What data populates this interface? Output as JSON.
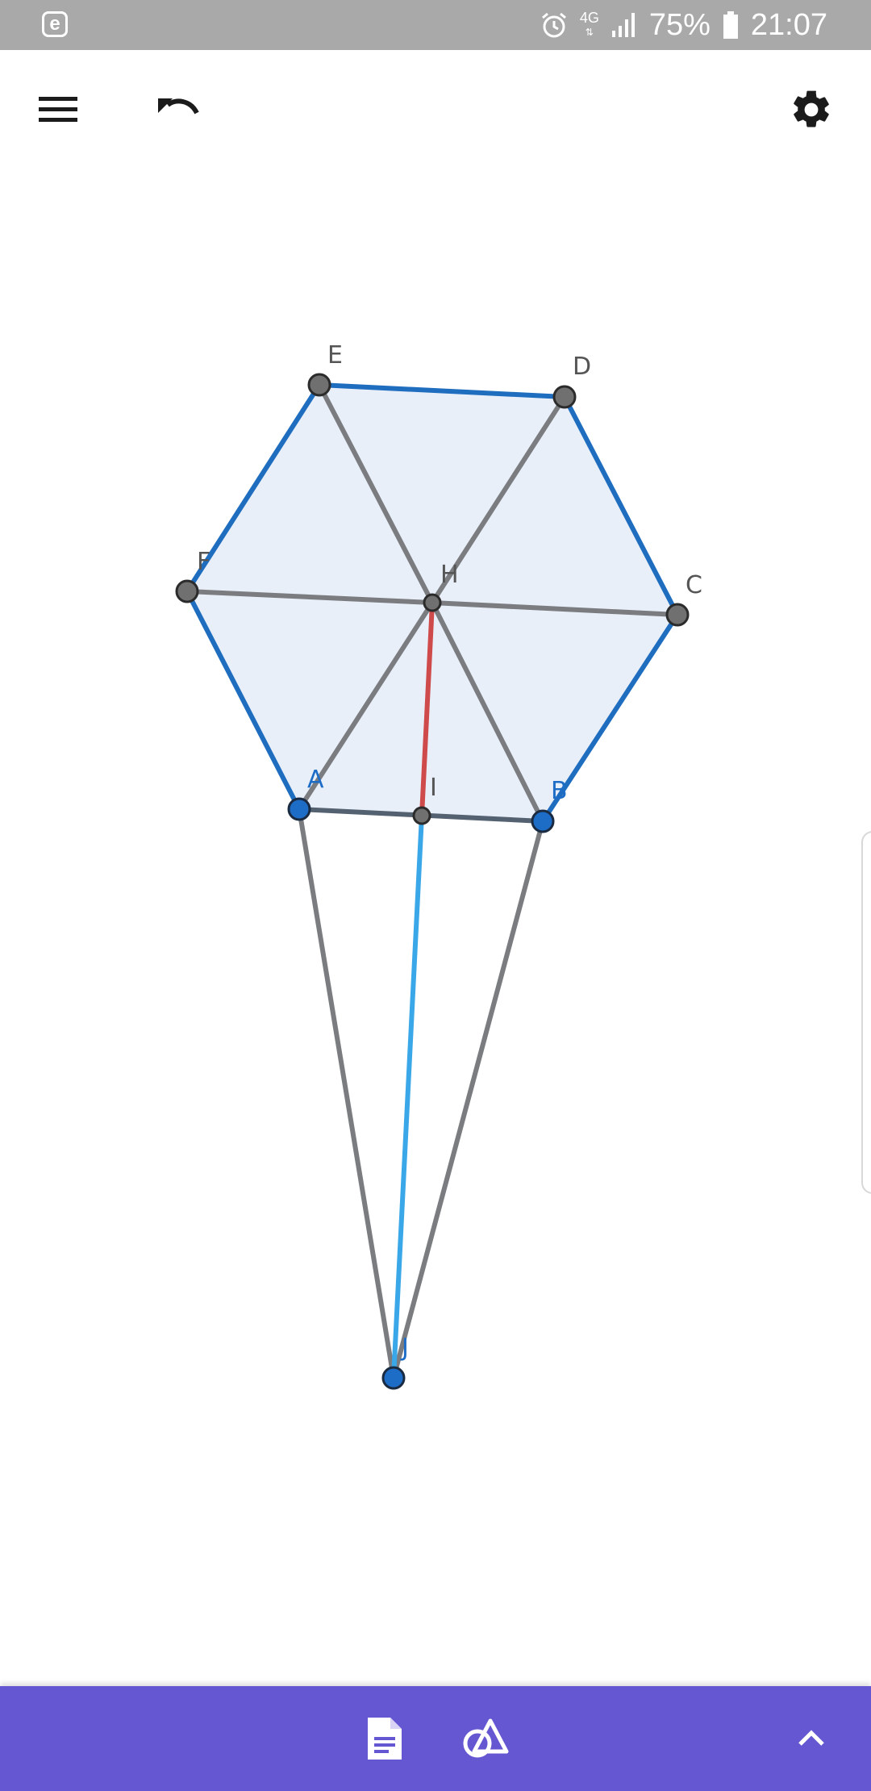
{
  "status_bar": {
    "left_icon_letter": "e",
    "network": "4G",
    "battery_percent": "75%",
    "time": "21:07",
    "icons": [
      "app-e-icon",
      "alarm-icon",
      "network-4g-icon",
      "signal-icon",
      "battery-icon"
    ]
  },
  "toolbar": {
    "menu_icon": "hamburger-menu-icon",
    "undo_icon": "undo-icon",
    "settings_icon": "gear-icon"
  },
  "geometry": {
    "points": {
      "A": "A",
      "B": "B",
      "C": "C",
      "D": "D",
      "E": "E",
      "F": "F",
      "H": "H",
      "I": "I",
      "J": "J"
    },
    "colors": {
      "polygon_fill": "#e8eff9",
      "polygon_edge": "#1f6dbf",
      "segment_gray": "#7a7c80",
      "segment_ab": "#546170",
      "segment_hi": "#cf4a4a",
      "segment_ij": "#3aa8e8",
      "free_point": "#1d6cc6",
      "dependent_point": "#707070"
    }
  },
  "bottom_bar": {
    "color": "#6557d2",
    "buttons": [
      "document-icon",
      "geometry-tools-icon",
      "chevron-up-icon"
    ]
  }
}
